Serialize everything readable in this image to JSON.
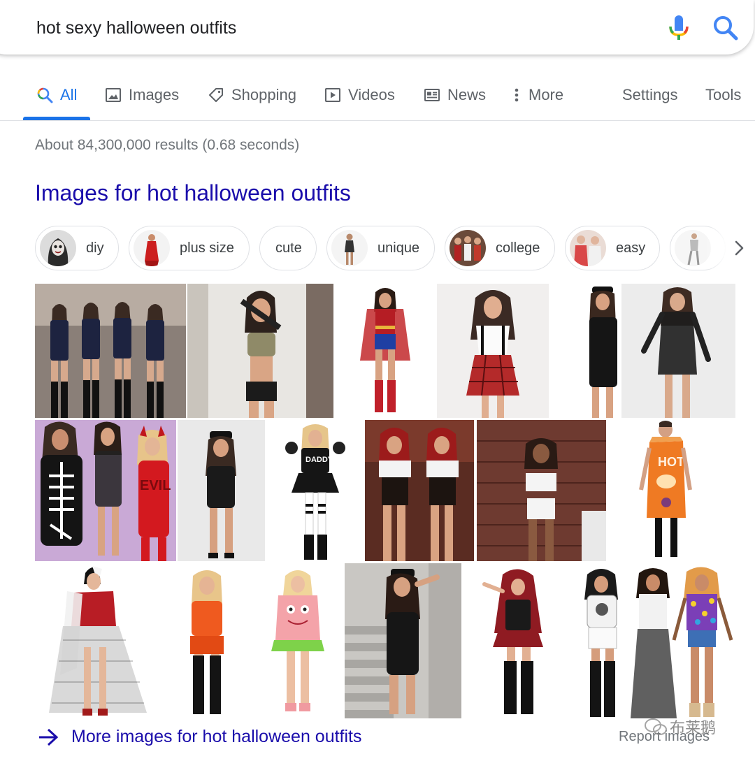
{
  "search": {
    "query": "hot sexy halloween outfits"
  },
  "colors": {
    "accent_blue": "#1a73e8",
    "link_blue": "#1a0dab",
    "text_gray": "#5f6368",
    "mic_red": "#ea4335",
    "mic_yellow": "#fbbc04",
    "mic_green": "#34a853"
  },
  "tabs": [
    {
      "label": "All",
      "icon": "search-icon",
      "active": true
    },
    {
      "label": "Images",
      "icon": "image-icon"
    },
    {
      "label": "Shopping",
      "icon": "tag-icon"
    },
    {
      "label": "Videos",
      "icon": "play-icon"
    },
    {
      "label": "News",
      "icon": "newspaper-icon"
    },
    {
      "label": "More",
      "icon": "vertical-dots-icon"
    }
  ],
  "tools": {
    "settings_label": "Settings",
    "tools_label": "Tools"
  },
  "results_stats": "About 84,300,000 results (0.68 seconds)",
  "images_section": {
    "heading": "Images for hot halloween outfits",
    "chips": [
      {
        "label": "diy"
      },
      {
        "label": "plus size"
      },
      {
        "label": "cute"
      },
      {
        "label": "unique"
      },
      {
        "label": "college"
      },
      {
        "label": "easy"
      }
    ],
    "more_link": "More images for hot halloween outfits",
    "report_link": "Report images"
  },
  "image_tile_text": {
    "devil_costume_text": "EVIL",
    "hot_sauce_costume_text": "HOT",
    "cheer_top_text": "DADDY"
  },
  "watermark_text": "布莱鹅"
}
